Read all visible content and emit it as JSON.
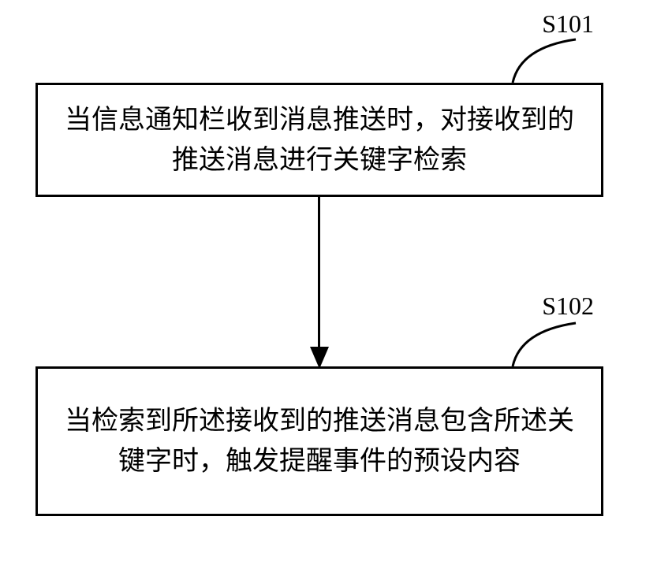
{
  "diagram": {
    "type": "flowchart",
    "steps": [
      {
        "id": "S101",
        "label": "S101",
        "text": "当信息通知栏收到消息推送时，对接收到的推送消息进行关键字检索"
      },
      {
        "id": "S102",
        "label": "S102",
        "text": "当检索到所述接收到的推送消息包含所述关键字时，触发提醒事件的预设内容"
      }
    ]
  }
}
